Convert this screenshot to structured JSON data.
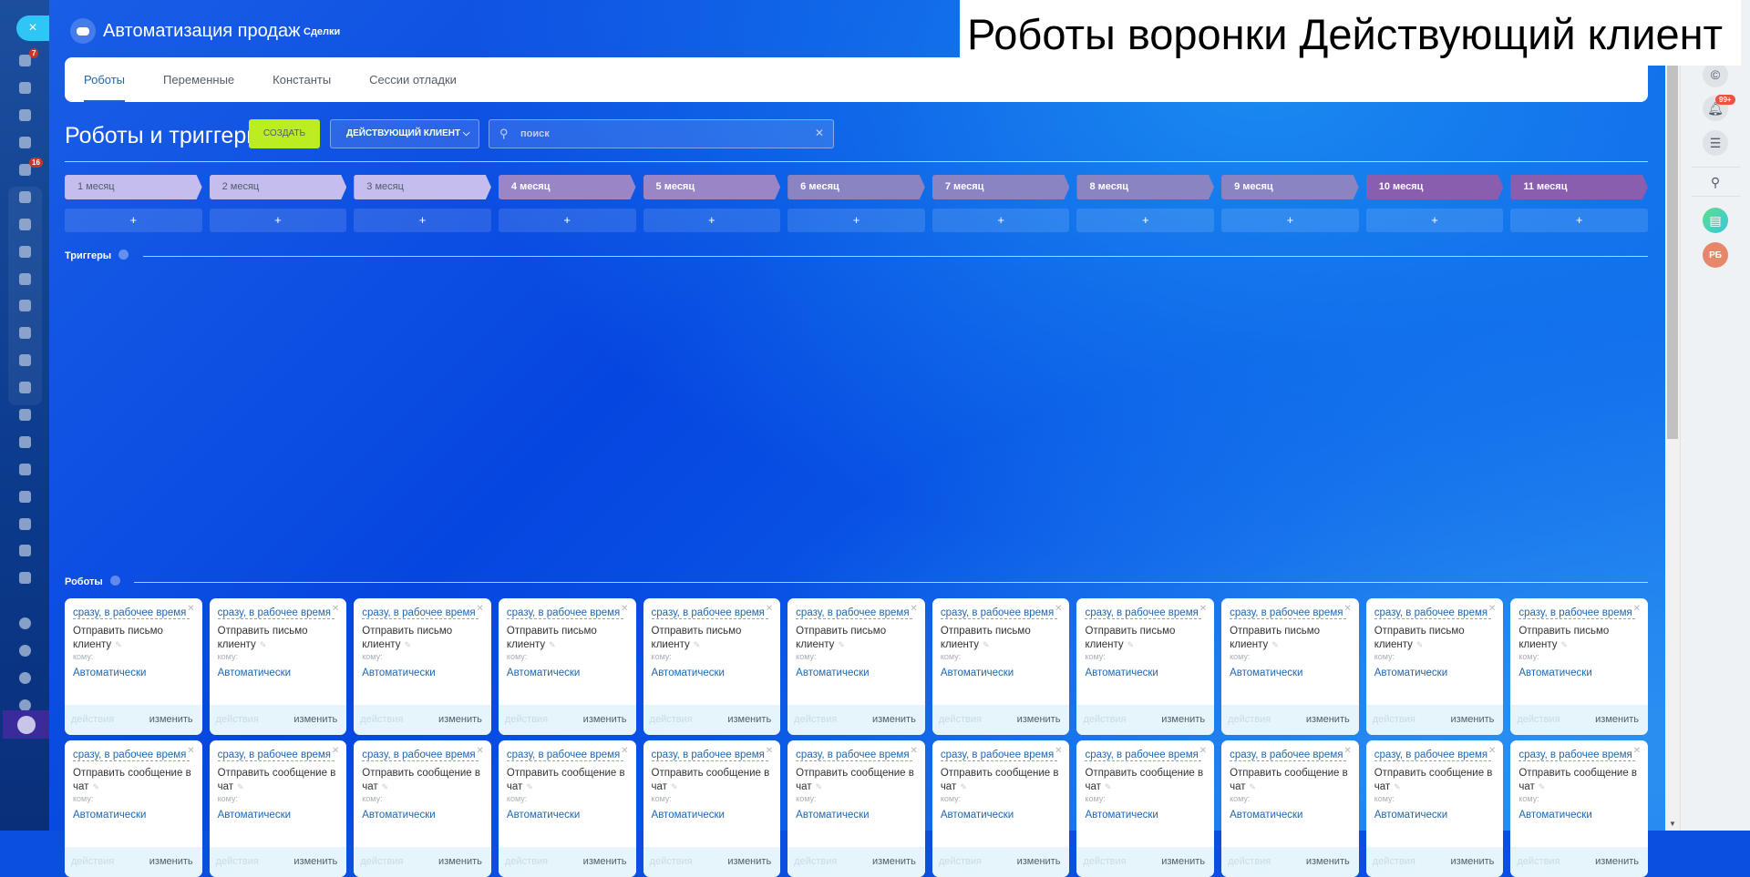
{
  "overlay_title": "Роботы воронки Действующий клиент",
  "header": {
    "title": "Автоматизация продаж",
    "subtitle": "Сделки"
  },
  "tabs": [
    {
      "label": "Роботы",
      "active": true
    },
    {
      "label": "Переменные"
    },
    {
      "label": "Константы"
    },
    {
      "label": "Сессии отладки"
    }
  ],
  "toolbar": {
    "title": "Роботы и триггеры",
    "create_label": "СОЗДАТЬ",
    "stage_select": "ДЕЙСТВУЮЩИЙ КЛИЕНТ",
    "search_placeholder": "поиск"
  },
  "sidebar": {
    "close_icon": "×",
    "badges": {
      "filter": "7",
      "tasks": "16"
    }
  },
  "stages": [
    {
      "label": "1 месяц",
      "color": "#c5bdee"
    },
    {
      "label": "2 месяц",
      "color": "#c5bdee"
    },
    {
      "label": "3 месяц",
      "color": "#c5bdee"
    },
    {
      "label": "4 месяц",
      "color": "#9a86c6"
    },
    {
      "label": "5 месяц",
      "color": "#9a86c6"
    },
    {
      "label": "6 месяц",
      "color": "#8a84c2"
    },
    {
      "label": "7 месяц",
      "color": "#8a84c2"
    },
    {
      "label": "8 месяц",
      "color": "#8a84c2"
    },
    {
      "label": "9 месяц",
      "color": "#8a84c2"
    },
    {
      "label": "10 месяц",
      "color": "#8a5eae"
    },
    {
      "label": "11 месяц",
      "color": "#8a5eae"
    }
  ],
  "add_label": "+",
  "triggers_label": "Триггеры",
  "robots_label": "Роботы",
  "robot_rows": [
    {
      "delay": "сразу, в рабочее время",
      "name": "Отправить письмо клиенту",
      "to_label": "кому:",
      "to_value": "Автоматически",
      "actions_label": "действия",
      "edit_label": "изменить",
      "count": 11
    },
    {
      "delay": "сразу, в рабочее время",
      "name": "Отправить сообщение в чат",
      "to_label": "кому:",
      "to_value": "Автоматически",
      "actions_label": "действия",
      "edit_label": "изменить",
      "count": 11
    }
  ],
  "right_panel": {
    "notifications_badge": "99+",
    "avatar_initials": "РБ"
  }
}
